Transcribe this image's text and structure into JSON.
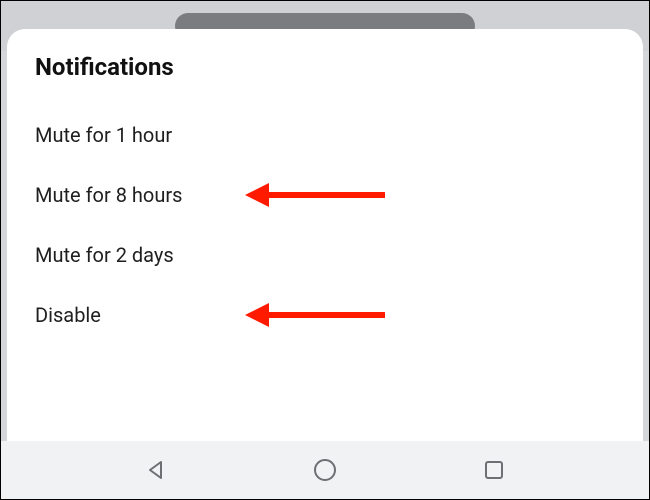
{
  "sheet": {
    "title": "Notifications",
    "options": [
      {
        "label": "Mute for 1 hour"
      },
      {
        "label": "Mute for 8 hours"
      },
      {
        "label": "Mute for 2 days"
      },
      {
        "label": "Disable"
      }
    ]
  },
  "annotations": {
    "color": "#ff1a00",
    "targets": [
      1,
      3
    ]
  }
}
